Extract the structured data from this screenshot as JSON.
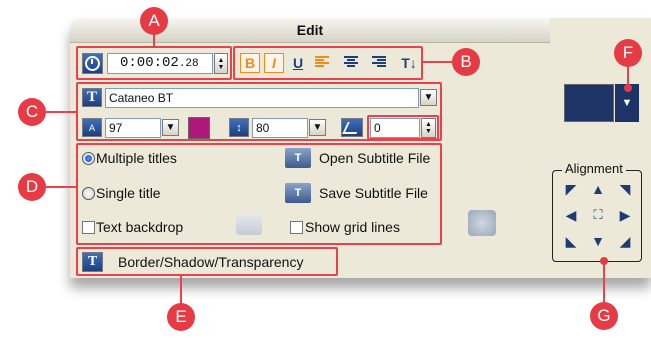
{
  "window": {
    "title": "Edit"
  },
  "timecode": {
    "value": "0:00:02",
    "frames": "28"
  },
  "format_buttons": {
    "bold": "B",
    "italic": "I",
    "underline": "U",
    "vertical": "T↓"
  },
  "font": {
    "name": "Cataneo BT",
    "size": "97",
    "line_spacing": "80",
    "angle": "0",
    "color": "#b0177a"
  },
  "options": {
    "multiple_titles": "Multiple titles",
    "single_title": "Single title",
    "text_backdrop": "Text backdrop",
    "open_subtitle": "Open Subtitle File",
    "save_subtitle": "Save Subtitle File",
    "show_grid": "Show grid lines"
  },
  "border_button": {
    "label": "Border/Shadow/Transparency"
  },
  "alignment": {
    "label": "Alignment"
  },
  "swatch": {
    "color": "#1f3466"
  },
  "callouts": {
    "a": "A",
    "b": "B",
    "c": "C",
    "d": "D",
    "e": "E",
    "f": "F",
    "g": "G"
  },
  "colors": {
    "callout": "#e63b45",
    "panel": "#ece9d8",
    "accent": "#f28a1e"
  }
}
